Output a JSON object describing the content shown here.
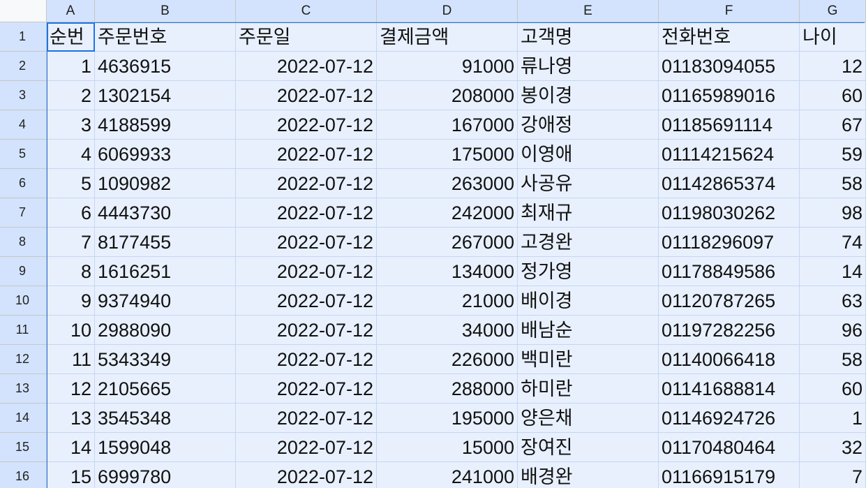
{
  "sheet": {
    "columns": [
      "A",
      "B",
      "C",
      "D",
      "E",
      "F",
      "G"
    ],
    "row_numbers": [
      "1",
      "2",
      "3",
      "4",
      "5",
      "6",
      "7",
      "8",
      "9",
      "10",
      "11",
      "12",
      "13",
      "14",
      "15",
      "16"
    ],
    "header": [
      "순번",
      "주문번호",
      "주문일",
      "결제금액",
      "고객명",
      "전화번호",
      "나이"
    ],
    "rows": [
      [
        "1",
        "4636915",
        "2022-07-12",
        "91000",
        "류나영",
        "01183094055",
        "12"
      ],
      [
        "2",
        "1302154",
        "2022-07-12",
        "208000",
        "봉이경",
        "01165989016",
        "60"
      ],
      [
        "3",
        "4188599",
        "2022-07-12",
        "167000",
        "강애정",
        "01185691114",
        "67"
      ],
      [
        "4",
        "6069933",
        "2022-07-12",
        "175000",
        "이영애",
        "01114215624",
        "59"
      ],
      [
        "5",
        "1090982",
        "2022-07-12",
        "263000",
        "사공유",
        "01142865374",
        "58"
      ],
      [
        "6",
        "4443730",
        "2022-07-12",
        "242000",
        "최재규",
        "01198030262",
        "98"
      ],
      [
        "7",
        "8177455",
        "2022-07-12",
        "267000",
        "고경완",
        "01118296097",
        "74"
      ],
      [
        "8",
        "1616251",
        "2022-07-12",
        "134000",
        "정가영",
        "01178849586",
        "14"
      ],
      [
        "9",
        "9374940",
        "2022-07-12",
        "21000",
        "배이경",
        "01120787265",
        "63"
      ],
      [
        "10",
        "2988090",
        "2022-07-12",
        "34000",
        "배남순",
        "01197282256",
        "96"
      ],
      [
        "11",
        "5343349",
        "2022-07-12",
        "226000",
        "백미란",
        "01140066418",
        "58"
      ],
      [
        "12",
        "2105665",
        "2022-07-12",
        "288000",
        "하미란",
        "01141688814",
        "60"
      ],
      [
        "13",
        "3545348",
        "2022-07-12",
        "195000",
        "양은채",
        "01146924726",
        "1"
      ],
      [
        "14",
        "1599048",
        "2022-07-12",
        "15000",
        "장여진",
        "01170480464",
        "32"
      ],
      [
        "15",
        "6999780",
        "2022-07-12",
        "241000",
        "배경완",
        "01166915179",
        "7"
      ]
    ],
    "align": [
      "right",
      "left",
      "right",
      "right",
      "left",
      "left",
      "right"
    ],
    "colors": {
      "selection_fill": "#e8f0fe",
      "selection_border": "#1a73e8",
      "header_bg": "#f8f9fa",
      "header_selected_bg": "#d3e3fd"
    }
  }
}
